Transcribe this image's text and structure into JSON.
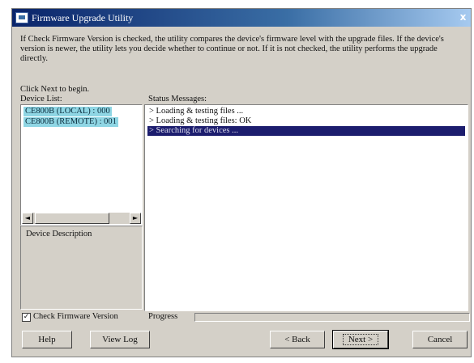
{
  "window": {
    "title": "Firmware Upgrade Utility",
    "close_glyph": "x"
  },
  "intro": {
    "text": "If Check Firmware Version is checked, the utility compares the device's firmware level with the upgrade files. If the device's version is newer, the utility lets you decide whether to continue or not. If it is not checked, the utility performs the upgrade directly.",
    "click_next": "Click Next to begin."
  },
  "devices": {
    "label": "Device List:",
    "items": [
      "CE800B (LOCAL) : 000",
      "CE800B (REMOTE) : 001"
    ],
    "scroll_left": "◄",
    "scroll_right": "►"
  },
  "description": {
    "label": "Device Description"
  },
  "status": {
    "label": "Status Messages:",
    "messages": [
      "> Loading & testing files ...",
      "> Loading & testing files: OK",
      "> Searching for devices ..."
    ],
    "selected_index": 2
  },
  "options": {
    "check_label": "Check Firmware Version",
    "checked": true,
    "check_mark": "✓"
  },
  "progress": {
    "label": "Progress",
    "value": 0
  },
  "buttons": {
    "help": "Help",
    "view_log": "View Log",
    "back": "< Back",
    "next": "Next >",
    "cancel": "Cancel"
  },
  "colors": {
    "title_start": "#0a246a",
    "title_end": "#a6caf0",
    "device_highlight": "#8fd6e4",
    "selection": "#1c1d6e",
    "face": "#d4d0c8"
  }
}
